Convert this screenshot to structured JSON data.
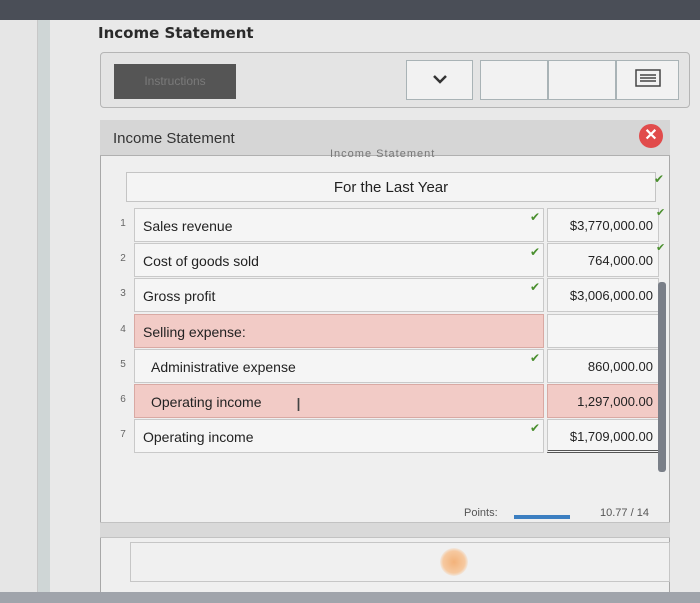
{
  "page_title": "Income Statement",
  "toolbar": {
    "instructions_label": "Instructions",
    "chevron_glyph": "⌄",
    "menu_glyph": "☰"
  },
  "dialog": {
    "title": "Income Statement",
    "close_glyph": "✕",
    "cut_header": "Income Statement",
    "period": "For the Last Year"
  },
  "rows": [
    {
      "num": "1",
      "label": "Sales revenue",
      "value": "$3,770,000.00"
    },
    {
      "num": "2",
      "label": "Cost of goods sold",
      "value": "764,000.00"
    },
    {
      "num": "3",
      "label": "Gross profit",
      "value": "$3,006,000.00"
    },
    {
      "num": "4",
      "label": "Selling expense:",
      "value": ""
    },
    {
      "num": "5",
      "label": "Administrative expense",
      "value": "860,000.00"
    },
    {
      "num": "6",
      "label": "Operating income",
      "value": "1,297,000.00"
    },
    {
      "num": "7",
      "label": "Operating income",
      "value": "$1,709,000.00"
    }
  ],
  "check_glyph": "✔",
  "cursor_glyph": "I",
  "footer": {
    "points_label": "Points:",
    "points_value": "10.77 / 14"
  },
  "colors": {
    "highlight_incorrect": "#f2cbc6",
    "correct_check": "#4a8f2e",
    "close_button": "#e14b4b",
    "points_bar": "#3c7fc1"
  }
}
